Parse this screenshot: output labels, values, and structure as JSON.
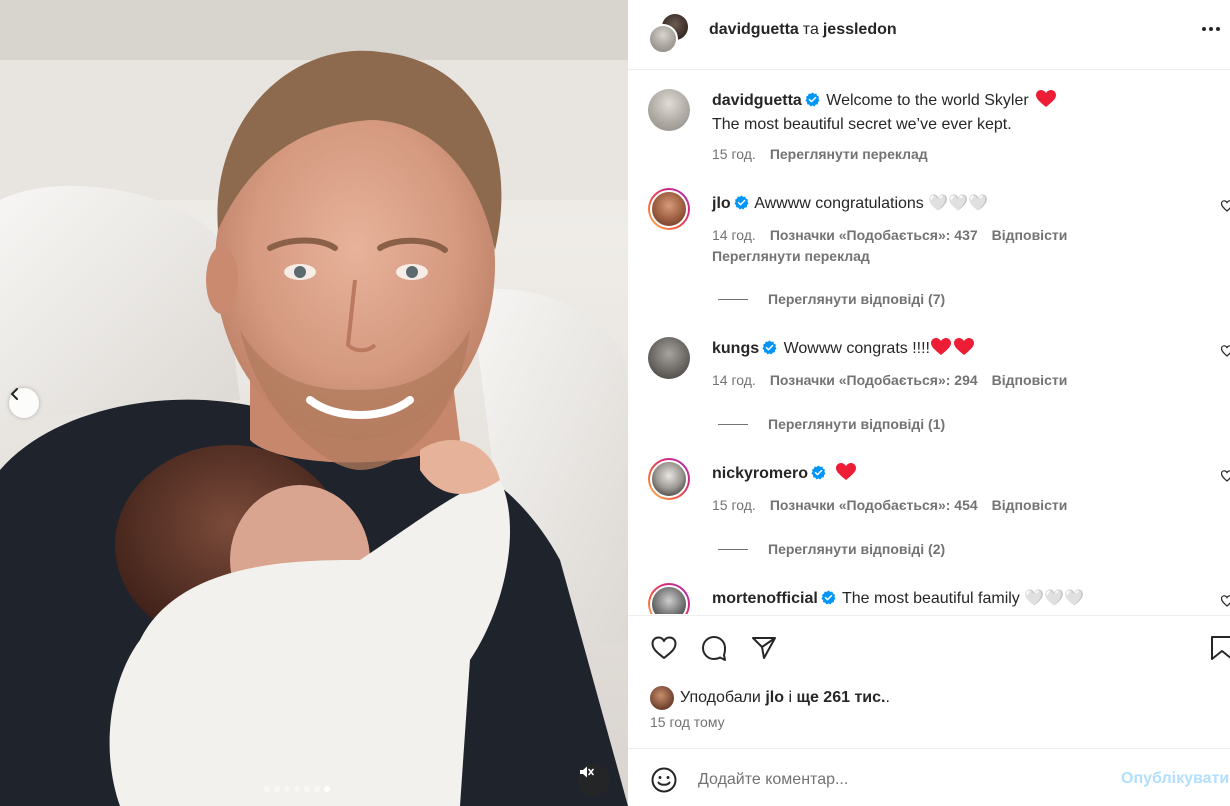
{
  "post": {
    "author": "davidguetta",
    "connector": "та",
    "collaborator": "jessledon",
    "media_slide_count": 7,
    "media_active_slide": 7
  },
  "caption": {
    "user": "davidguetta",
    "text_line1": "Welcome to the world Skyler",
    "text_line2": "The most beautiful secret we’ve ever kept.",
    "time": "15 год.",
    "translate_label": "Переглянути переклад"
  },
  "comments": [
    {
      "user": "jlo",
      "text": "Awwww congratulations 🤍🤍🤍",
      "time": "14 год.",
      "likes_label": "Позначки «Подобається»: 437",
      "reply_label": "Відповісти",
      "translate_label": "Переглянути переклад",
      "view_replies": "Переглянути відповіді (7)"
    },
    {
      "user": "kungs",
      "text": "Wowww congrats !!!!",
      "time": "14 год.",
      "likes_label": "Позначки «Подобається»: 294",
      "reply_label": "Відповісти",
      "view_replies": "Переглянути відповіді (1)"
    },
    {
      "user": "nickyromero",
      "text": "",
      "time": "15 год.",
      "likes_label": "Позначки «Подобається»: 454",
      "reply_label": "Відповісти",
      "view_replies": "Переглянути відповіді (2)"
    },
    {
      "user": "mortenofficial",
      "text": "The most beautiful family 🤍🤍🤍"
    }
  ],
  "likes": {
    "prefix": "Уподобали",
    "user": "jlo",
    "middle": "і",
    "rest": "ще 261 тис.",
    "suffix": "."
  },
  "timestamp": "15 год тому",
  "composer": {
    "placeholder": "Додайте коментар...",
    "publish_label": "Опублікувати"
  },
  "colors": {
    "verified": "#0095f6",
    "heart": "#ed1d35",
    "muted_text": "#737373",
    "publish_disabled": "#b2dffc"
  }
}
